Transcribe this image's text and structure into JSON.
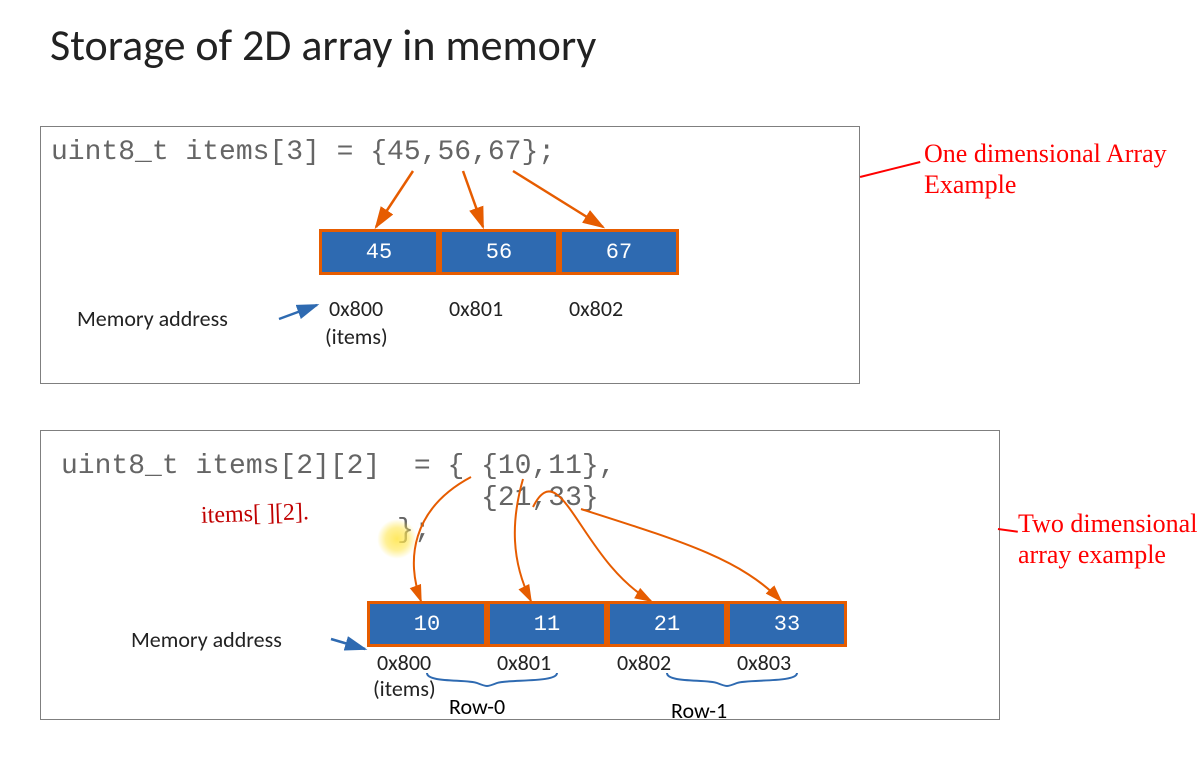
{
  "title": "Storage of 2D array in memory",
  "callouts": {
    "one_d": "One dimensional Array\nExample",
    "two_d": "Two dimensional\narray example"
  },
  "example1": {
    "code": "uint8_t items[3] = {45,56,67};",
    "cells": [
      "45",
      "56",
      "67"
    ],
    "addresses": [
      "0x800",
      "0x801",
      "0x802"
    ],
    "addr_label": "Memory address",
    "items_note": "(items)"
  },
  "example2": {
    "code_line1": "uint8_t items[2][2]  = { {10,11},",
    "code_line2": "                         {21,33}",
    "code_line3": "                    };",
    "handwriting": "items[ ][2].",
    "cells": [
      "10",
      "11",
      "21",
      "33"
    ],
    "addresses": [
      "0x800",
      "0x801",
      "0x802",
      "0x803"
    ],
    "addr_label": "Memory address",
    "items_note": "(items)",
    "row0_label": "Row-0",
    "row1_label": "Row-1"
  }
}
